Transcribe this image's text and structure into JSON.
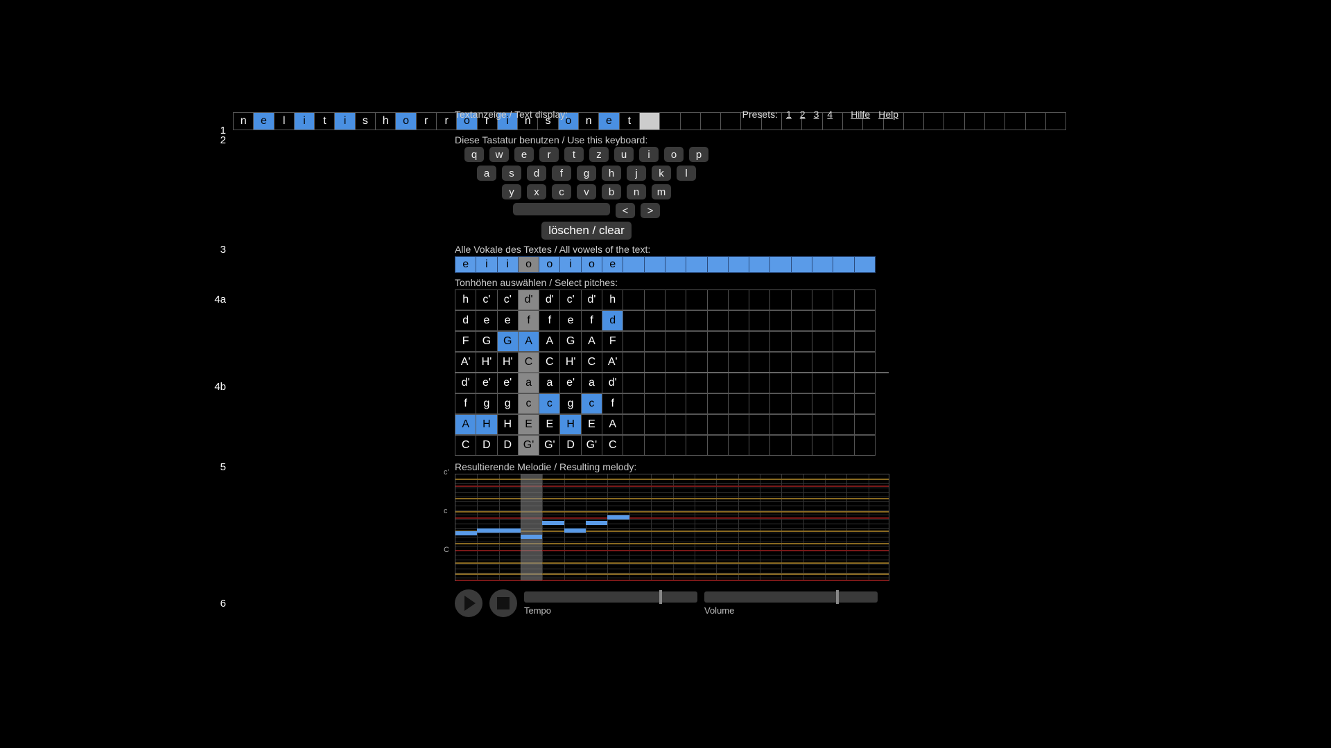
{
  "labels": {
    "step1": "1",
    "step2": "2",
    "step3": "3",
    "step4a": "4a",
    "step4b": "4b",
    "step5": "5",
    "step6": "6",
    "text_display": "Textanzeige / Text display:",
    "use_keyboard": "Diese Tastatur benutzen / Use this keyboard:",
    "clear": "löschen / clear",
    "all_vowels": "Alle Vokale des Textes / All vowels of the text:",
    "select_pitches": "Tonhöhen auswählen / Select pitches:",
    "resulting_melody": "Resultierende Melodie / Resulting melody:",
    "presets": "Presets:",
    "preset1": "1",
    "preset2": "2",
    "preset3": "3",
    "preset4": "4",
    "hilfe": "Hilfe",
    "help": "Help",
    "tempo": "Tempo",
    "volume": "Volume",
    "roll_c_high": "c'",
    "roll_c_mid": "c",
    "roll_c_low": "C"
  },
  "text_cells": {
    "total": 41,
    "letters": [
      "n",
      "e",
      "l",
      "i",
      "t",
      "i",
      "s",
      "h",
      "o",
      "r",
      "r",
      "o",
      "r",
      "i",
      "n",
      "s",
      "o",
      "n",
      "e",
      "t"
    ],
    "vowel_indices": [
      1,
      3,
      5,
      8,
      11,
      13,
      16,
      18
    ],
    "cursor_index": 20
  },
  "keyboard": {
    "row1": [
      "q",
      "w",
      "e",
      "r",
      "t",
      "z",
      "u",
      "i",
      "o",
      "p"
    ],
    "row2": [
      "a",
      "s",
      "d",
      "f",
      "g",
      "h",
      "j",
      "k",
      "l"
    ],
    "row3": [
      "y",
      "x",
      "c",
      "v",
      "b",
      "n",
      "m"
    ],
    "nav": [
      "<",
      ">"
    ]
  },
  "vowels": {
    "total": 20,
    "cells": [
      "e",
      "i",
      "i",
      "o",
      "o",
      "i",
      "o",
      "e"
    ],
    "selected_index": 3
  },
  "pitches": {
    "total_cols": 20,
    "rows": [
      [
        "h",
        "c'",
        "c'",
        "d'",
        "d'",
        "c'",
        "d'",
        "h"
      ],
      [
        "d",
        "e",
        "e",
        "f",
        "f",
        "e",
        "f",
        "d"
      ],
      [
        "F",
        "G",
        "G",
        "A",
        "A",
        "G",
        "A",
        "F"
      ],
      [
        "A'",
        "H'",
        "H'",
        "C",
        "C",
        "H'",
        "C",
        "A'"
      ],
      [
        "d'",
        "e'",
        "e'",
        "a",
        "a",
        "e'",
        "a",
        "d'"
      ],
      [
        "f",
        "g",
        "g",
        "c",
        "c",
        "g",
        "c",
        "f"
      ],
      [
        "A",
        "H",
        "H",
        "E",
        "E",
        "H",
        "E",
        "A"
      ],
      [
        "C",
        "D",
        "D",
        "G'",
        "G'",
        "D",
        "G'",
        "C"
      ]
    ],
    "selected_col": 3,
    "blue_cells": [
      {
        "r": 1,
        "c": 7
      },
      {
        "r": 2,
        "c": 2
      },
      {
        "r": 2,
        "c": 3
      },
      {
        "r": 5,
        "c": 4
      },
      {
        "r": 5,
        "c": 6
      },
      {
        "r": 6,
        "c": 0
      },
      {
        "r": 6,
        "c": 1
      },
      {
        "r": 6,
        "c": 5
      }
    ],
    "divider_after_row": 4
  },
  "melody": {
    "cols": 20,
    "play_col": 3,
    "oct_lines_pct": [
      10,
      40,
      70,
      98
    ],
    "gold_lines_pct": [
      4,
      22,
      34,
      52,
      64,
      82,
      92
    ],
    "notes": [
      {
        "col": 0,
        "y_pct": 55
      },
      {
        "col": 1,
        "y_pct": 52
      },
      {
        "col": 2,
        "y_pct": 52
      },
      {
        "col": 3,
        "y_pct": 58
      },
      {
        "col": 4,
        "y_pct": 45
      },
      {
        "col": 5,
        "y_pct": 52
      },
      {
        "col": 6,
        "y_pct": 45
      },
      {
        "col": 7,
        "y_pct": 40
      }
    ]
  },
  "sliders": {
    "tempo_pct": 78,
    "volume_pct": 76
  }
}
